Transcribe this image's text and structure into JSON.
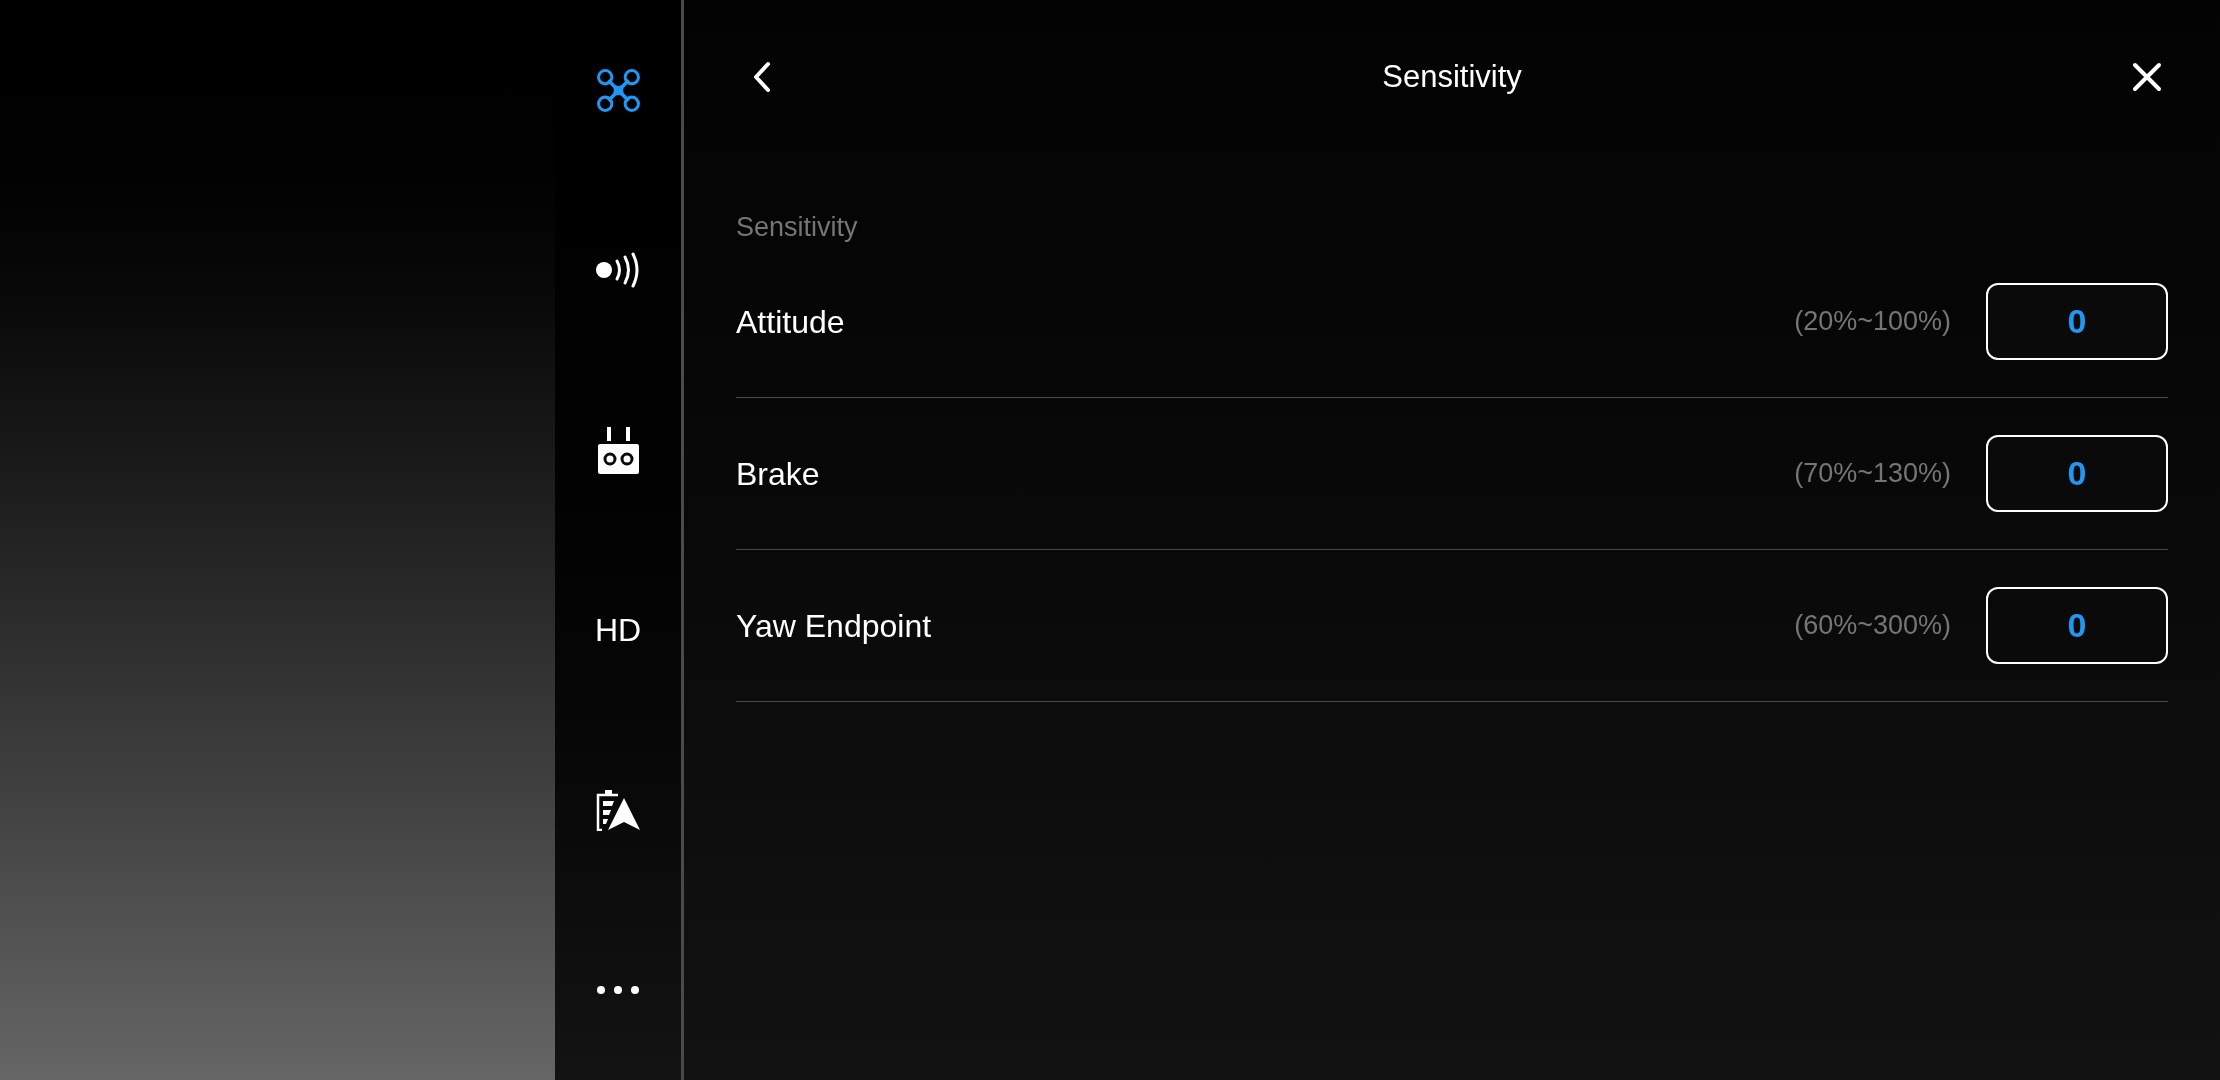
{
  "sidebar": {
    "items": [
      {
        "kind": "icon",
        "selected": true
      },
      {
        "kind": "icon",
        "selected": false
      },
      {
        "kind": "icon",
        "selected": false
      },
      {
        "kind": "text",
        "label": "HD",
        "selected": false
      },
      {
        "kind": "icon",
        "selected": false
      },
      {
        "kind": "icon",
        "selected": false
      }
    ]
  },
  "header": {
    "title": "Sensitivity"
  },
  "section": {
    "label": "Sensitivity",
    "rows": [
      {
        "label": "Attitude",
        "range": "(20%~100%)",
        "value": "0"
      },
      {
        "label": "Brake",
        "range": "(70%~130%)",
        "value": "0"
      },
      {
        "label": "Yaw Endpoint",
        "range": "(60%~300%)",
        "value": "0"
      }
    ]
  }
}
